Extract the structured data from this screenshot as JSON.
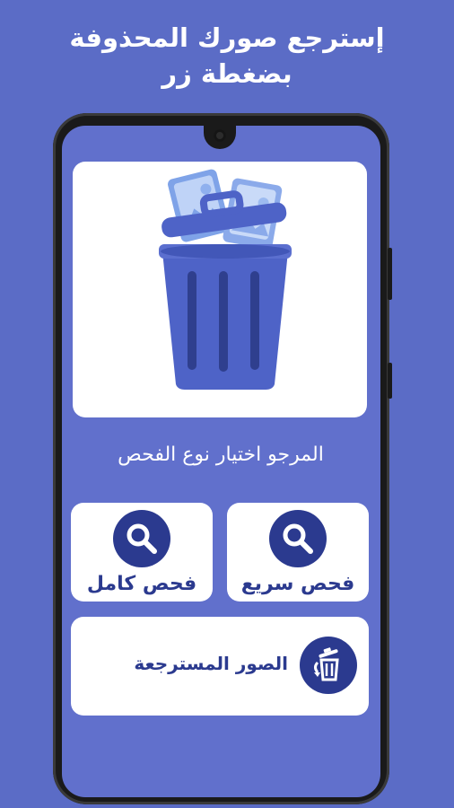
{
  "promo": {
    "headline_line1": "إسترجع صورك المحذوفة",
    "headline_line2": "بضغطة زر"
  },
  "app": {
    "prompt": "المرجو اختيار نوع الفحص",
    "quick_scan_label": "فحص سريع",
    "full_scan_label": "فحص كامل",
    "recovered_photos_label": "الصور المسترجعة"
  },
  "icons": {
    "hero": "trash-bin-with-photos-icon",
    "quick_scan": "magnifier-icon",
    "full_scan": "magnifier-icon",
    "recovered": "restore-trash-icon"
  },
  "colors": {
    "background": "#5B6CC6",
    "screen": "#6170CC",
    "accent": "#2B3A8F",
    "trash": "#4E63C7"
  }
}
